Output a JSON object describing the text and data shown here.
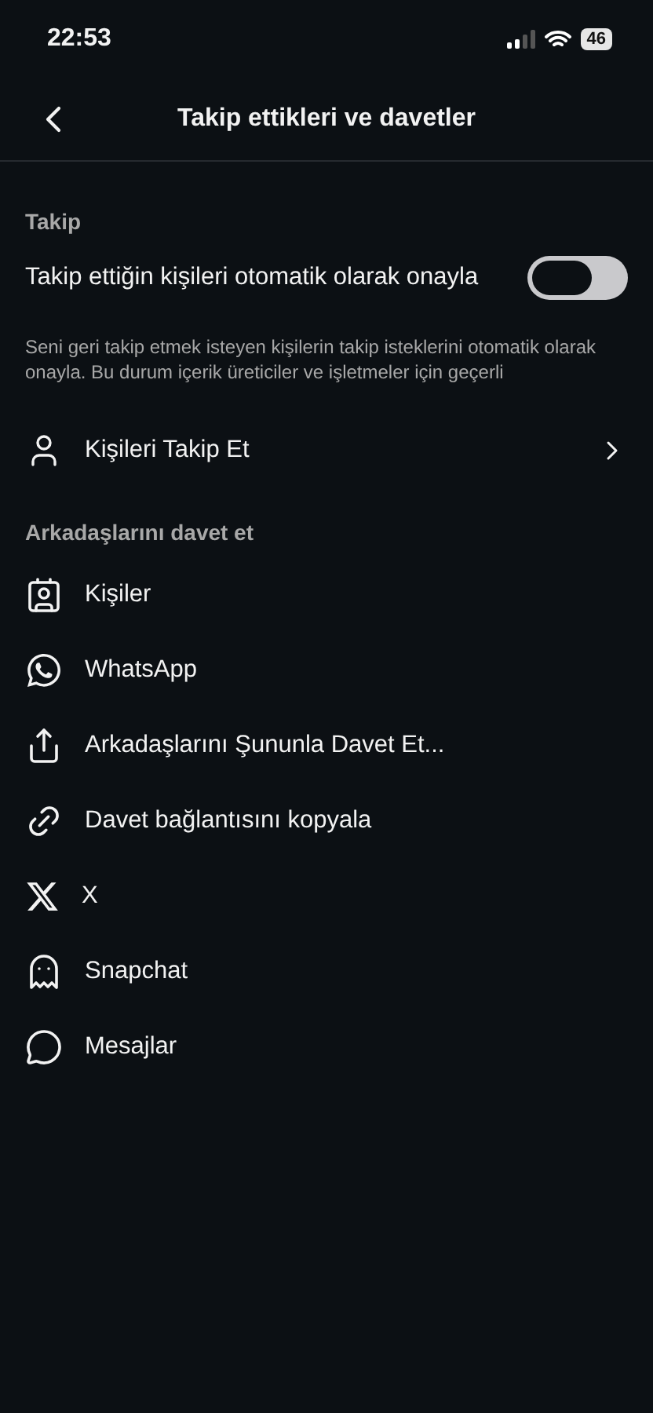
{
  "status_bar": {
    "time": "22:53",
    "battery": "46"
  },
  "header": {
    "title": "Takip ettikleri ve davetler"
  },
  "follow_section": {
    "title": "Takip",
    "toggle": {
      "label": "Takip ettiğin kişileri otomatik olarak onayla",
      "on": false
    },
    "description": "Seni geri takip etmek isteyen kişilerin takip isteklerini otomatik olarak onayla. Bu durum içerik üreticiler ve işletmeler için geçerli",
    "link": {
      "label": "Kişileri Takip Et",
      "kind": "person"
    }
  },
  "invite_section": {
    "title": "Arkadaşlarını davet et",
    "items": [
      {
        "label": "Kişiler",
        "kind": "contacts"
      },
      {
        "label": "WhatsApp",
        "kind": "whatsapp"
      },
      {
        "label": "Arkadaşlarını Şununla Davet Et...",
        "kind": "share"
      },
      {
        "label": "Davet bağlantısını kopyala",
        "kind": "link"
      },
      {
        "label": "X",
        "kind": "x"
      },
      {
        "label": "Snapchat",
        "kind": "snapchat"
      },
      {
        "label": "Mesajlar",
        "kind": "message"
      }
    ]
  }
}
